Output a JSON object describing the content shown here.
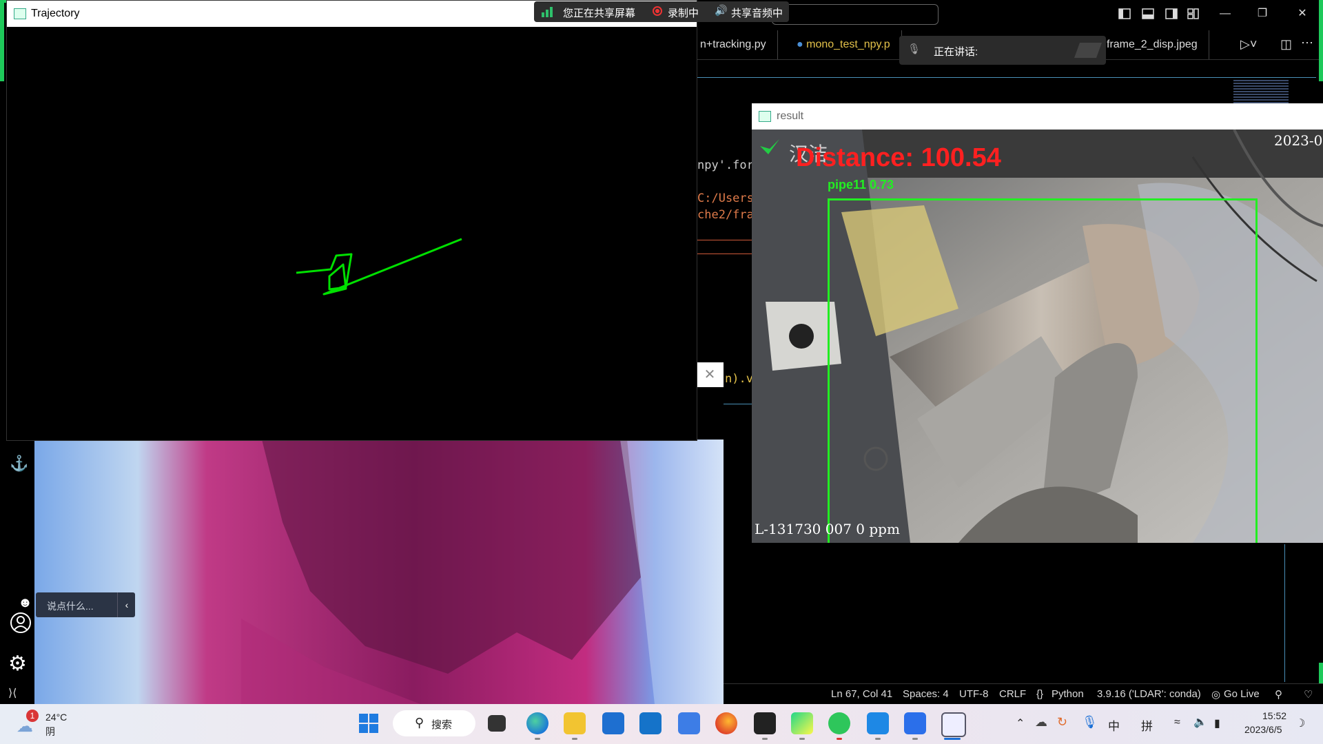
{
  "trajectory_window": {
    "title": "Trajectory"
  },
  "share_bar": {
    "sharing": "您正在共享屏幕",
    "recording": "录制中",
    "audio": "共享音频中"
  },
  "speaking_panel": {
    "label": "正在讲话:"
  },
  "vscode": {
    "tabs": [
      "n+tracking.py",
      "mono_test_npy.p",
      "frame_2_disp.jpeg"
    ],
    "code": [
      "npy'.for",
      "C:/Users",
      "che2/fra",
      "n).v"
    ],
    "status": {
      "position": "Ln 67, Col 41",
      "spaces": "Spaces: 4",
      "encoding": "UTF-8",
      "eol": "CRLF",
      "language": "Python",
      "interpreter": "3.9.16 ('LDAR': conda)",
      "golive": "Go Live"
    }
  },
  "result_window": {
    "title": "result",
    "distance": "Distance: 100.54",
    "detection_label": "pipe11 0.73",
    "date": "2023-0",
    "watermark": "汉洁",
    "footer_text": "L-131730 007 0 ppm"
  },
  "chat": {
    "placeholder": "说点什么..."
  },
  "taskbar": {
    "weather_temp": "24°C",
    "weather_desc": "阴",
    "weather_badge": "1",
    "search_label": "搜索",
    "ime_lang": "中",
    "ime_mode": "拼",
    "time": "15:52",
    "date": "2023/6/5"
  },
  "colors": {
    "green_accent": "#1ec95a",
    "trajectory": "#00e000",
    "distance_red": "#ff2020",
    "box_green": "#22ee22"
  }
}
